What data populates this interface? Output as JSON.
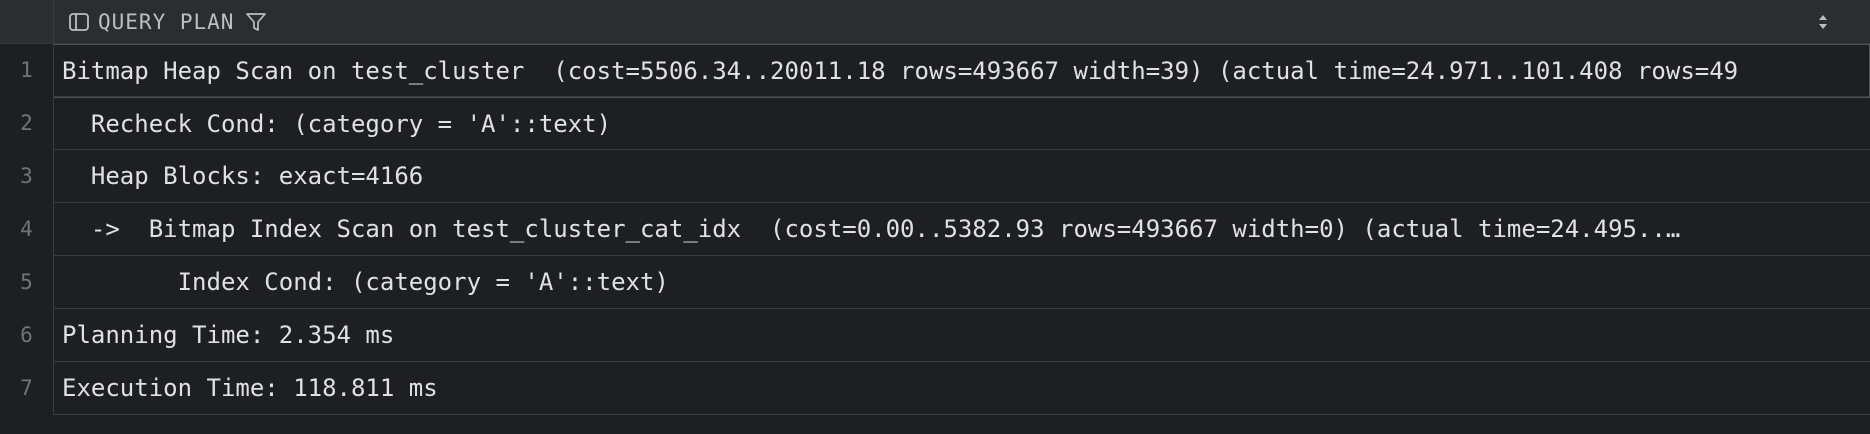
{
  "column": {
    "title": "QUERY PLAN",
    "panel_icon": "panel-icon",
    "filter_icon": "filter-icon",
    "sort_icon": "sort-arrows-icon"
  },
  "rows": [
    {
      "num": "1",
      "text": "Bitmap Heap Scan on test_cluster  (cost=5506.34..20011.18 rows=493667 width=39) (actual time=24.971..101.408 rows=49"
    },
    {
      "num": "2",
      "text": "  Recheck Cond: (category = 'A'::text)"
    },
    {
      "num": "3",
      "text": "  Heap Blocks: exact=4166"
    },
    {
      "num": "4",
      "text": "  ->  Bitmap Index Scan on test_cluster_cat_idx  (cost=0.00..5382.93 rows=493667 width=0) (actual time=24.495..…"
    },
    {
      "num": "5",
      "text": "        Index Cond: (category = 'A'::text)"
    },
    {
      "num": "6",
      "text": "Planning Time: 2.354 ms"
    },
    {
      "num": "7",
      "text": "Execution Time: 118.811 ms"
    }
  ],
  "colors": {
    "background": "#1e1f22",
    "header": "#2b2d30",
    "border": "#393b40",
    "text": "#dfe1e5",
    "line_number": "#6f737a"
  }
}
